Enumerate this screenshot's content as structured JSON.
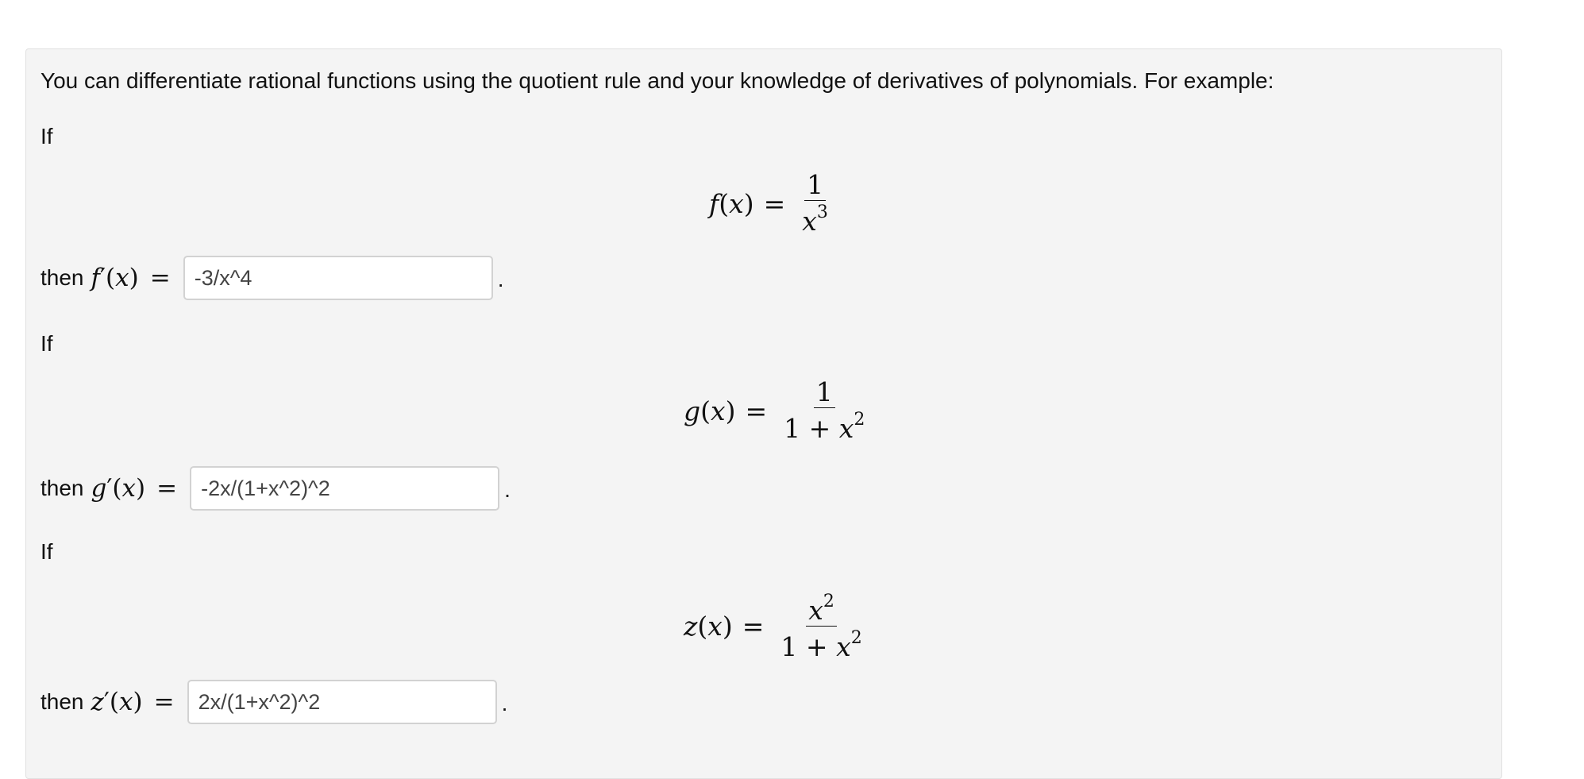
{
  "intro": "You can differentiate rational functions using the quotient rule and your knowledge of derivatives of polynomials. For example:",
  "problems": [
    {
      "if_label": "If",
      "func_name": "f",
      "numerator": "1",
      "denominator_base": "x",
      "denominator_prefix": "",
      "denominator_exp": "3",
      "then_label": "then",
      "answer": "-3/x^4",
      "period": "."
    },
    {
      "if_label": "If",
      "func_name": "g",
      "numerator": "1",
      "denominator_prefix": "1 + ",
      "denominator_base": "x",
      "denominator_exp": "2",
      "then_label": "then",
      "answer": "-2x/(1+x^2)^2",
      "period": "."
    },
    {
      "if_label": "If",
      "func_name": "z",
      "numerator_base": "x",
      "numerator_exp": "2",
      "denominator_prefix": "1 + ",
      "denominator_base": "x",
      "denominator_exp": "2",
      "then_label": "then",
      "answer": "2x/(1+x^2)^2",
      "period": "."
    }
  ],
  "math": {
    "var": "x",
    "open_paren": "(",
    "close_paren": ")",
    "equals": "=",
    "prime": "′"
  }
}
